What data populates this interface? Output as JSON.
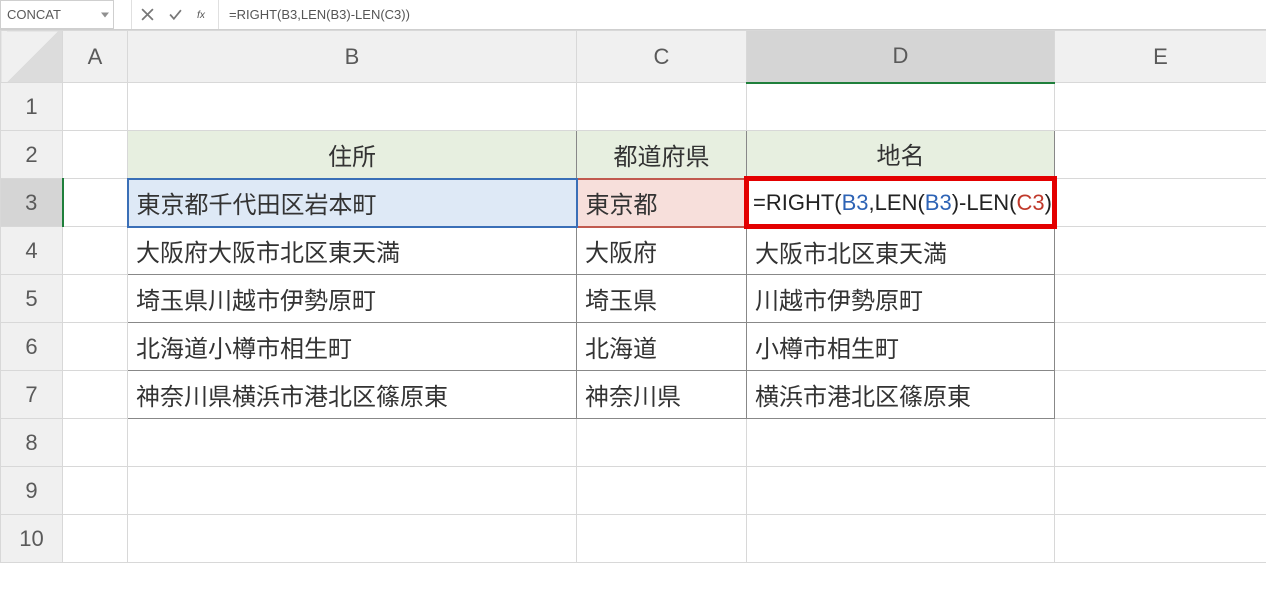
{
  "formula_bar": {
    "name_box": "CONCAT",
    "formula_text": "=RIGHT(B3,LEN(B3)-LEN(C3))"
  },
  "column_headers": [
    "A",
    "B",
    "C",
    "D",
    "E"
  ],
  "row_headers": [
    "1",
    "2",
    "3",
    "4",
    "5",
    "6",
    "7",
    "8",
    "9",
    "10"
  ],
  "headers": {
    "B": "住所",
    "C": "都道府県",
    "D": "地名"
  },
  "active_cell": {
    "row": 3,
    "col": "D",
    "formula_tokens": [
      {
        "t": "=RIGHT(",
        "c": "black"
      },
      {
        "t": "B3",
        "c": "blue"
      },
      {
        "t": ",LEN(",
        "c": "black"
      },
      {
        "t": "B3",
        "c": "blue"
      },
      {
        "t": ")-LEN(",
        "c": "black"
      },
      {
        "t": "C3",
        "c": "red"
      },
      {
        "t": "))",
        "c": "black"
      }
    ]
  },
  "rows": [
    {
      "B": "東京都千代田区岩本町",
      "C": "東京都",
      "D": ""
    },
    {
      "B": "大阪府大阪市北区東天満",
      "C": "大阪府",
      "D": "大阪市北区東天満"
    },
    {
      "B": "埼玉県川越市伊勢原町",
      "C": "埼玉県",
      "D": "川越市伊勢原町"
    },
    {
      "B": "北海道小樽市相生町",
      "C": "北海道",
      "D": "小樽市相生町"
    },
    {
      "B": "神奈川県横浜市港北区篠原東",
      "C": "神奈川県",
      "D": "横浜市港北区篠原東"
    }
  ]
}
